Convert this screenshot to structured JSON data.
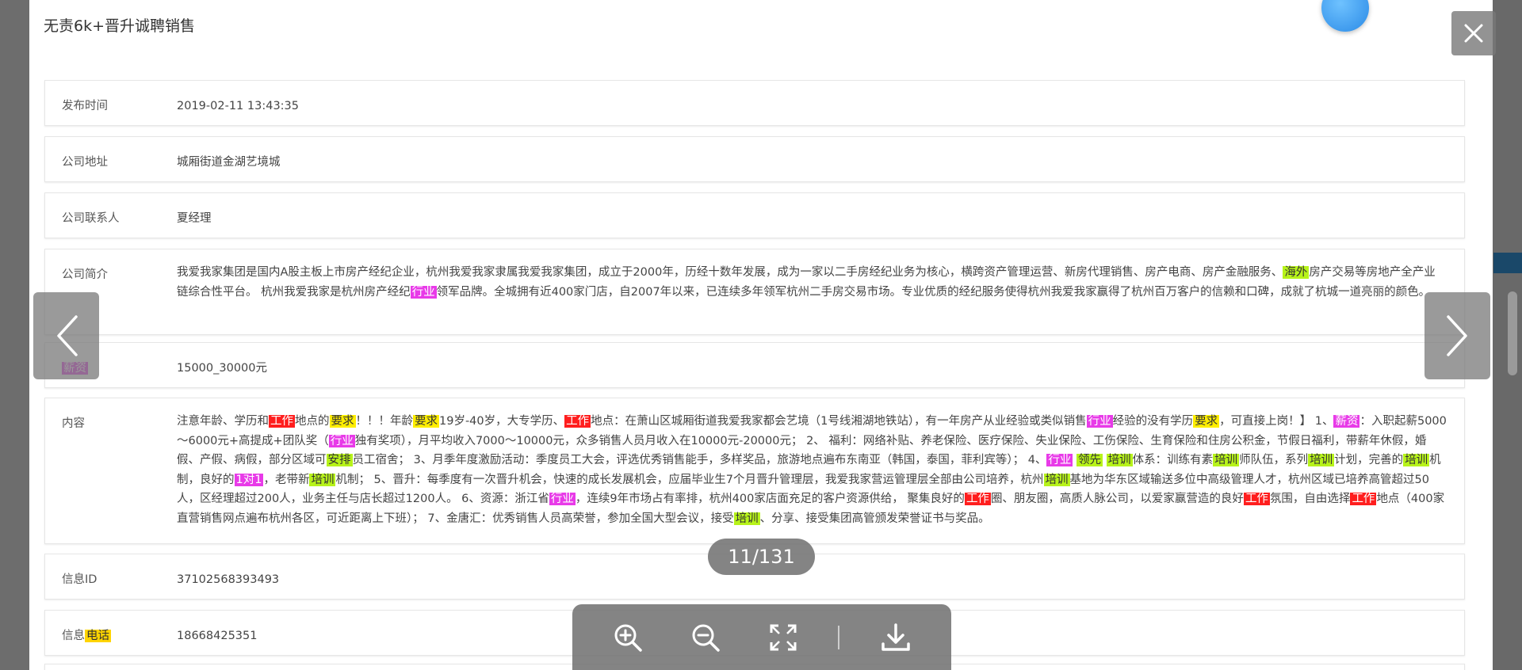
{
  "modal": {
    "title": "无责6k+晋升诚聘销售",
    "rows": {
      "publish_time": {
        "label": "发布时间",
        "value": "2019-02-11 13:43:35"
      },
      "address": {
        "label": "公司地址",
        "value": "城厢街道金湖艺境城"
      },
      "contact": {
        "label": "公司联系人",
        "value": "夏经理"
      },
      "intro": {
        "label": "公司简介",
        "segments": [
          {
            "t": "我爱我家集团是国内A股主板上市房产经纪企业，杭州我爱我家隶属我爱我家集团，成立于2000年，历经十数年发展，成为一家以二手房经纪业务为核心，横跨资产管理运营、新房代理销售、房产电商、房产金融服务、"
          },
          {
            "t": "海外",
            "hl": "green"
          },
          {
            "t": "房产交易等房地产全产业链综合性平台。 杭州我爱我家是杭州房产经纪"
          },
          {
            "t": "行业",
            "hl": "magenta"
          },
          {
            "t": "领军品牌。全城拥有近400家门店，自2007年以来，已连续多年领军杭州二手房交易市场。专业优质的经纪服务使得杭州我爱我家赢得了杭州百万客户的信赖和口碑，成就了杭城一道亮丽的颜色。"
          }
        ]
      },
      "salary": {
        "label": "薪资",
        "value": "15000_30000元"
      },
      "content": {
        "label": "内容",
        "segments": [
          {
            "t": "注意年龄、学历和"
          },
          {
            "t": "工作",
            "hl": "red"
          },
          {
            "t": "地点的"
          },
          {
            "t": "要求",
            "hl": "yellow"
          },
          {
            "t": "！！！年龄"
          },
          {
            "t": "要求",
            "hl": "yellow"
          },
          {
            "t": "19岁-40岁，大专学历、"
          },
          {
            "t": "工作",
            "hl": "red"
          },
          {
            "t": "地点：在萧山区城厢街道我爱我家都会艺境（1号线湘湖地铁站），有一年房产从业经验或类似销售"
          },
          {
            "t": "行业",
            "hl": "magenta"
          },
          {
            "t": "经验的没有学历"
          },
          {
            "t": "要求",
            "hl": "yellow"
          },
          {
            "t": "，可直接上岗！】 1、"
          },
          {
            "t": "薪资",
            "hl": "magenta"
          },
          {
            "t": "：入职起薪5000～6000元+高提成+团队奖（"
          },
          {
            "t": "行业",
            "hl": "magenta"
          },
          {
            "t": "独有奖项），月平均收入7000～10000元，众多销售人员月收入在10000元-20000元； 2、 福利：网络补贴、养老保险、医疗保险、失业保险、工伤保险、生育保险和住房公积金，节假日福利，带薪年休假，婚假、产假、病假，部分区域可"
          },
          {
            "t": "安排",
            "hl": "green"
          },
          {
            "t": "员工宿舍； 3、月季年度激励活动：季度员工大会，评选优秀销售能手，多样奖品，旅游地点遍布东南亚（韩国，泰国，菲利宾等）； 4、"
          },
          {
            "t": "行业",
            "hl": "magenta"
          },
          {
            "t": " "
          },
          {
            "t": "领先",
            "hl": "green"
          },
          {
            "t": " "
          },
          {
            "t": "培训",
            "hl": "green"
          },
          {
            "t": "体系：训练有素"
          },
          {
            "t": "培训",
            "hl": "green"
          },
          {
            "t": "师队伍，系列"
          },
          {
            "t": "培训",
            "hl": "green"
          },
          {
            "t": "计划，完善的"
          },
          {
            "t": "培训",
            "hl": "green"
          },
          {
            "t": "机制，良好的"
          },
          {
            "t": "1对1",
            "hl": "magenta"
          },
          {
            "t": "，老带新"
          },
          {
            "t": "培训",
            "hl": "green"
          },
          {
            "t": "机制； 5、晋升：每季度有一次晋升机会，快速的成长发展机会，应届毕业生7个月晋升管理层，我爱我家营运管理层全部由公司培养，杭州"
          },
          {
            "t": "培训",
            "hl": "green"
          },
          {
            "t": "基地为华东区域输送多位中高级管理人才，杭州区域已培养高管超过50人，区经理超过200人，业务主任与店长超过1200人。 6、资源：浙江省"
          },
          {
            "t": "行业",
            "hl": "magenta"
          },
          {
            "t": "，连续9年市场占有率排，杭州400家店面充足的客户资源供给， 聚集良好的"
          },
          {
            "t": "工作",
            "hl": "red"
          },
          {
            "t": "圈、朋友圈，高质人脉公司，以爱家赢营造的良好"
          },
          {
            "t": "工作",
            "hl": "red"
          },
          {
            "t": "氛围，自由选择"
          },
          {
            "t": "工作",
            "hl": "red"
          },
          {
            "t": "地点（400家直营销售网点遍布杭州各区，可近距离上下班）； 7、金唐汇：优秀销售人员高荣誉，参加全国大型会议，接受"
          },
          {
            "t": "培训",
            "hl": "green"
          },
          {
            "t": "、分享、接受集团高管颁发荣誉证书与奖品。"
          }
        ]
      },
      "info_id": {
        "label": "信息ID",
        "value": "37102568393493"
      },
      "phone": {
        "label_prefix": "信息",
        "label_hl": "电话",
        "value": "18668425351"
      }
    }
  },
  "viewer": {
    "counter": "11/131",
    "tools": [
      "zoom-in-icon",
      "zoom-out-icon",
      "fullscreen-icon",
      "download-icon"
    ]
  },
  "colors": {
    "hl_red": "#ff1e1e",
    "hl_yellow": "#ffee00",
    "hl_magenta": "#e83ae8",
    "hl_green": "#b7f31a"
  }
}
